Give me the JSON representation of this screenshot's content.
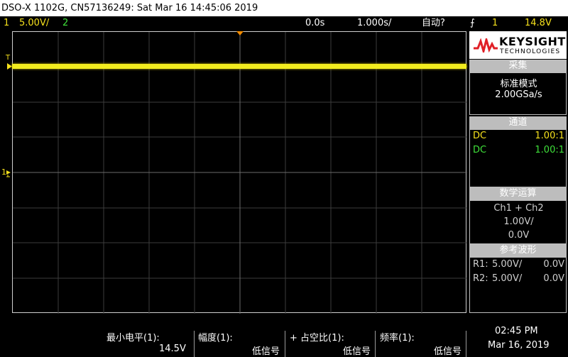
{
  "titlebar": {
    "text": "DSO-X 1102G, CN57136249: Sat Mar 16 14:45:06 2019"
  },
  "topbar": {
    "ch1_num": "1",
    "ch1_scale": "5.00V/",
    "ch2_num": "2",
    "time_offset": "0.0s",
    "time_scale": "1.000s/",
    "trigger_mode": "自动?",
    "trig_source": "1",
    "trig_level": "14.8V"
  },
  "grid": {
    "trigger_marker": "T",
    "ch1_marker": "1"
  },
  "logo": {
    "brand": "KEYSIGHT",
    "sub": "TECHNOLOGIES"
  },
  "acquire": {
    "title": "采集",
    "mode": "标准模式",
    "rate": "2.00GSa/s"
  },
  "channels": {
    "title": "通道",
    "rows": [
      {
        "coupling": "DC",
        "probe": "1.00:1",
        "color": "#f5e01c"
      },
      {
        "coupling": "DC",
        "probe": "1.00:1",
        "color": "#3fe03a"
      }
    ]
  },
  "math": {
    "title": "数学运算",
    "func": "Ch1 + Ch2",
    "scale": "1.00V/",
    "offset": "0.0V"
  },
  "reference": {
    "title": "参考波形",
    "rows": [
      {
        "label": "R1:",
        "scale": "5.00V/",
        "offset": "0.0V"
      },
      {
        "label": "R2:",
        "scale": "5.00V/",
        "offset": "0.0V"
      }
    ]
  },
  "measurements": [
    {
      "label": "最小电平(1):",
      "value": "14.5V"
    },
    {
      "label": "幅度(1):",
      "value": "低信号"
    },
    {
      "label": "+ 占空比(1):",
      "value": "低信号"
    },
    {
      "label": "频率(1):",
      "value": "低信号"
    }
  ],
  "clock": {
    "time": "02:45 PM",
    "date": "Mar 16, 2019"
  }
}
